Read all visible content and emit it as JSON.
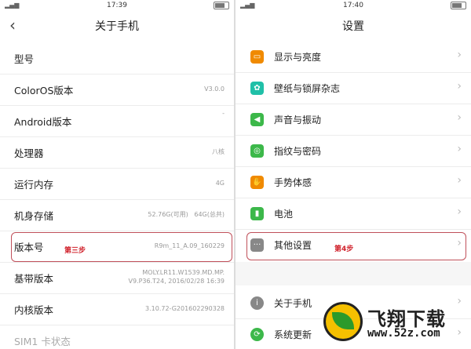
{
  "left": {
    "status_time": "17:39",
    "title": "关于手机",
    "back_icon": "chevron-left-icon",
    "rows": [
      {
        "label": "型号",
        "value": ""
      },
      {
        "label": "ColorOS版本",
        "value": "V3.0.0"
      },
      {
        "label": "Android版本",
        "value": "-"
      },
      {
        "label": "处理器",
        "value": "八核"
      },
      {
        "label": "运行内存",
        "value": "4G"
      },
      {
        "label": "机身存储",
        "value": "52.76G(可用)   64G(总共)"
      },
      {
        "label": "版本号",
        "value": "R9m_11_A.09_160229"
      },
      {
        "label": "基带版本",
        "value": "MOLY.LR11.W1539.MD.MP.\nV9.P36.T24, 2016/02/28 16:39"
      },
      {
        "label": "内核版本",
        "value": "3.10.72-G201602290328"
      },
      {
        "label": "SIM1 卡状态",
        "value": ""
      }
    ],
    "step_label": "第三步"
  },
  "right": {
    "status_time": "17:40",
    "title": "设置",
    "items": [
      {
        "label": "显示与亮度",
        "icon": "display-icon",
        "color": "#f08a00"
      },
      {
        "label": "壁纸与锁屏杂志",
        "icon": "wallpaper-icon",
        "color": "#20c0a8"
      },
      {
        "label": "声音与振动",
        "icon": "sound-icon",
        "color": "#3cb84a"
      },
      {
        "label": "指纹与密码",
        "icon": "fingerprint-icon",
        "color": "#3cb84a"
      },
      {
        "label": "手势体感",
        "icon": "gesture-icon",
        "color": "#f08a00"
      },
      {
        "label": "电池",
        "icon": "battery-icon",
        "color": "#3cb84a"
      },
      {
        "label": "其他设置",
        "icon": "more-icon",
        "color": "#888888"
      },
      {
        "label": "关于手机",
        "icon": "info-icon",
        "color": "#888888"
      },
      {
        "label": "系统更新",
        "icon": "update-icon",
        "color": "#3cb84a"
      }
    ],
    "step_label": "第4步"
  },
  "watermark": {
    "title": "飞翔下载",
    "url": "www.52z.com"
  }
}
